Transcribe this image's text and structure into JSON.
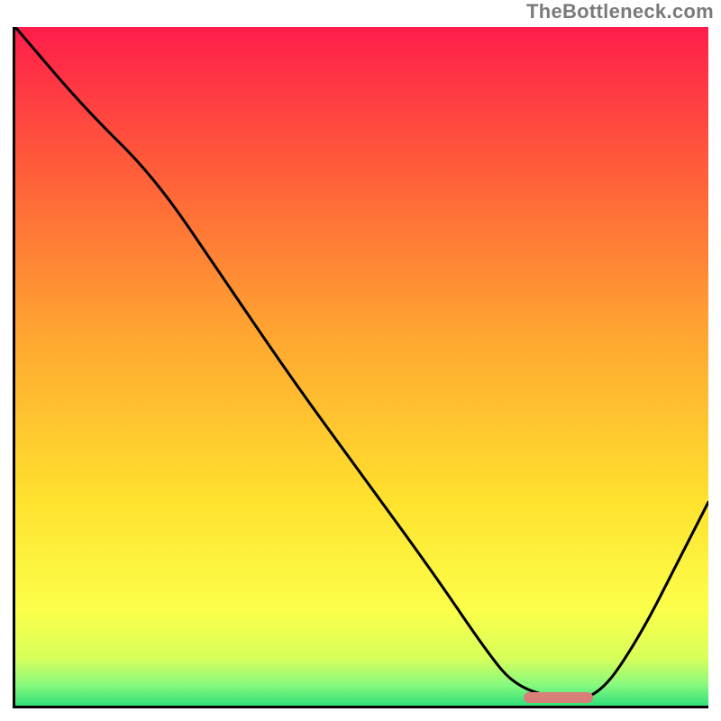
{
  "watermark": "TheBottleneck.com",
  "chart_data": {
    "type": "line",
    "title": "",
    "xlabel": "",
    "ylabel": "",
    "xlim": [
      0,
      100
    ],
    "ylim": [
      0,
      100
    ],
    "grid": false,
    "legend": false,
    "gradient_stops": [
      {
        "offset": 0.0,
        "color": "#ff1d4b"
      },
      {
        "offset": 0.2,
        "color": "#ff5a3a"
      },
      {
        "offset": 0.45,
        "color": "#ffa531"
      },
      {
        "offset": 0.7,
        "color": "#ffe22e"
      },
      {
        "offset": 0.86,
        "color": "#fbff4a"
      },
      {
        "offset": 0.93,
        "color": "#d8ff5a"
      },
      {
        "offset": 0.97,
        "color": "#86f97e"
      },
      {
        "offset": 1.0,
        "color": "#2fe07a"
      }
    ],
    "curve": {
      "x": [
        0,
        10,
        20,
        30,
        40,
        50,
        60,
        68,
        72,
        78,
        84,
        90,
        96,
        100
      ],
      "y": [
        100,
        88,
        78,
        63,
        48,
        34,
        20,
        8,
        3,
        1,
        1,
        10,
        22,
        30
      ]
    },
    "optimum_marker": {
      "x_start": 73,
      "x_end": 83,
      "y": 0.8,
      "color": "#d97f7a"
    }
  }
}
